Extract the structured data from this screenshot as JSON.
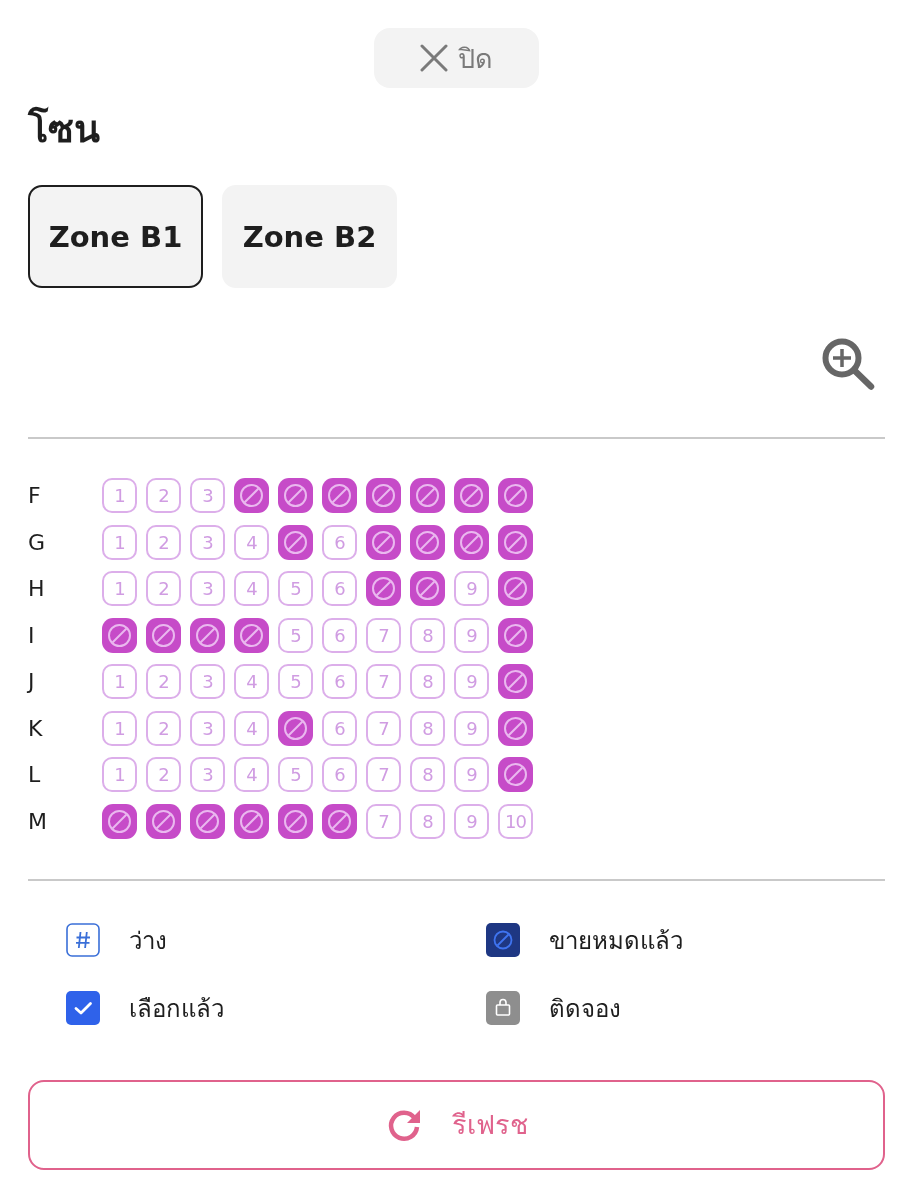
{
  "close_button": {
    "label": "ปิด"
  },
  "heading": "โซน",
  "zone_tabs": [
    {
      "label": "Zone B1",
      "selected": true
    },
    {
      "label": "Zone B2",
      "selected": false
    }
  ],
  "seat_rows": [
    {
      "row": "F",
      "seats": [
        {
          "kind": "available",
          "label": "1"
        },
        {
          "kind": "available",
          "label": "2"
        },
        {
          "kind": "available",
          "label": "3"
        },
        {
          "kind": "sold"
        },
        {
          "kind": "sold"
        },
        {
          "kind": "sold"
        },
        {
          "kind": "sold"
        },
        {
          "kind": "sold"
        },
        {
          "kind": "sold"
        },
        {
          "kind": "sold"
        }
      ]
    },
    {
      "row": "G",
      "seats": [
        {
          "kind": "available",
          "label": "1"
        },
        {
          "kind": "available",
          "label": "2"
        },
        {
          "kind": "available",
          "label": "3"
        },
        {
          "kind": "available",
          "label": "4"
        },
        {
          "kind": "sold"
        },
        {
          "kind": "available",
          "label": "6"
        },
        {
          "kind": "sold"
        },
        {
          "kind": "sold"
        },
        {
          "kind": "sold"
        },
        {
          "kind": "sold"
        }
      ]
    },
    {
      "row": "H",
      "seats": [
        {
          "kind": "available",
          "label": "1"
        },
        {
          "kind": "available",
          "label": "2"
        },
        {
          "kind": "available",
          "label": "3"
        },
        {
          "kind": "available",
          "label": "4"
        },
        {
          "kind": "available",
          "label": "5"
        },
        {
          "kind": "available",
          "label": "6"
        },
        {
          "kind": "sold"
        },
        {
          "kind": "sold"
        },
        {
          "kind": "available",
          "label": "9"
        },
        {
          "kind": "sold"
        }
      ]
    },
    {
      "row": "I",
      "seats": [
        {
          "kind": "sold"
        },
        {
          "kind": "sold"
        },
        {
          "kind": "sold"
        },
        {
          "kind": "sold"
        },
        {
          "kind": "available",
          "label": "5"
        },
        {
          "kind": "available",
          "label": "6"
        },
        {
          "kind": "available",
          "label": "7"
        },
        {
          "kind": "available",
          "label": "8"
        },
        {
          "kind": "available",
          "label": "9"
        },
        {
          "kind": "sold"
        }
      ]
    },
    {
      "row": "J",
      "seats": [
        {
          "kind": "available",
          "label": "1"
        },
        {
          "kind": "available",
          "label": "2"
        },
        {
          "kind": "available",
          "label": "3"
        },
        {
          "kind": "available",
          "label": "4"
        },
        {
          "kind": "available",
          "label": "5"
        },
        {
          "kind": "available",
          "label": "6"
        },
        {
          "kind": "available",
          "label": "7"
        },
        {
          "kind": "available",
          "label": "8"
        },
        {
          "kind": "available",
          "label": "9"
        },
        {
          "kind": "sold"
        }
      ]
    },
    {
      "row": "K",
      "seats": [
        {
          "kind": "available",
          "label": "1"
        },
        {
          "kind": "available",
          "label": "2"
        },
        {
          "kind": "available",
          "label": "3"
        },
        {
          "kind": "available",
          "label": "4"
        },
        {
          "kind": "sold"
        },
        {
          "kind": "available",
          "label": "6"
        },
        {
          "kind": "available",
          "label": "7"
        },
        {
          "kind": "available",
          "label": "8"
        },
        {
          "kind": "available",
          "label": "9"
        },
        {
          "kind": "sold"
        }
      ]
    },
    {
      "row": "L",
      "seats": [
        {
          "kind": "available",
          "label": "1"
        },
        {
          "kind": "available",
          "label": "2"
        },
        {
          "kind": "available",
          "label": "3"
        },
        {
          "kind": "available",
          "label": "4"
        },
        {
          "kind": "available",
          "label": "5"
        },
        {
          "kind": "available",
          "label": "6"
        },
        {
          "kind": "available",
          "label": "7"
        },
        {
          "kind": "available",
          "label": "8"
        },
        {
          "kind": "available",
          "label": "9"
        },
        {
          "kind": "sold"
        }
      ]
    },
    {
      "row": "M",
      "seats": [
        {
          "kind": "sold"
        },
        {
          "kind": "sold"
        },
        {
          "kind": "sold"
        },
        {
          "kind": "sold"
        },
        {
          "kind": "sold"
        },
        {
          "kind": "sold"
        },
        {
          "kind": "available",
          "label": "7"
        },
        {
          "kind": "available",
          "label": "8"
        },
        {
          "kind": "available",
          "label": "9"
        },
        {
          "kind": "available",
          "label": "10"
        }
      ]
    }
  ],
  "legend": [
    {
      "kind": "available",
      "label": "ว่าง"
    },
    {
      "kind": "sold",
      "label": "ขายหมดแล้ว"
    },
    {
      "kind": "selected",
      "label": "เลือกแล้ว"
    },
    {
      "kind": "reserved",
      "label": "ติดจอง"
    }
  ],
  "refresh_button": {
    "label": "รีเฟรช"
  }
}
